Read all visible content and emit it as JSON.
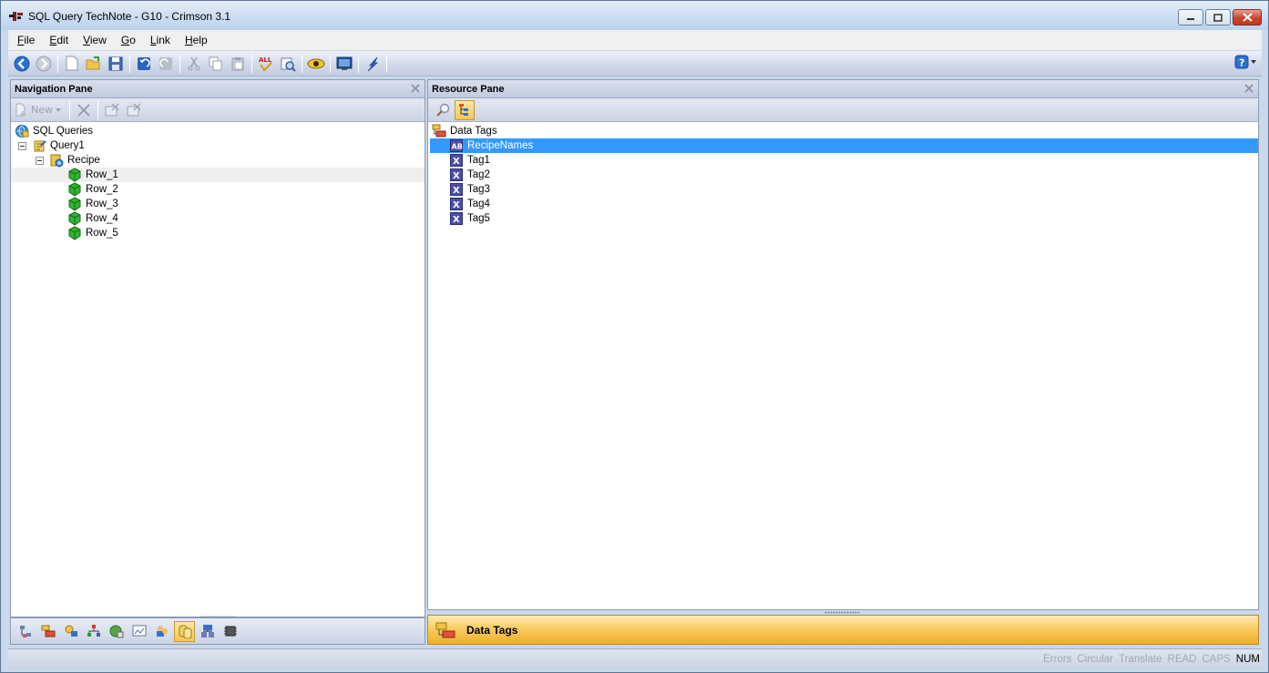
{
  "window": {
    "title": "SQL Query TechNote - G10 - Crimson 3.1"
  },
  "menu": {
    "items": [
      {
        "label": "File",
        "key": "F",
        "rest": "ile"
      },
      {
        "label": "Edit",
        "key": "E",
        "rest": "dit"
      },
      {
        "label": "View",
        "key": "V",
        "rest": "iew"
      },
      {
        "label": "Go",
        "key": "G",
        "rest": "o"
      },
      {
        "label": "Link",
        "key": "L",
        "rest": "ink"
      },
      {
        "label": "Help",
        "key": "H",
        "rest": "elp"
      }
    ]
  },
  "navigation_pane": {
    "title": "Navigation Pane",
    "new_button_label": "New",
    "tree": {
      "root": "SQL Queries",
      "query": "Query1",
      "table": "Recipe",
      "rows": [
        "Row_1",
        "Row_2",
        "Row_3",
        "Row_4",
        "Row_5"
      ],
      "selected": "Row_1"
    }
  },
  "resource_pane": {
    "title": "Resource Pane",
    "tree": {
      "root": "Data Tags",
      "items": [
        {
          "label": "RecipeNames",
          "kind": "string-tag",
          "selected": true
        },
        {
          "label": "Tag1",
          "kind": "numeric-tag",
          "selected": false
        },
        {
          "label": "Tag2",
          "kind": "numeric-tag",
          "selected": false
        },
        {
          "label": "Tag3",
          "kind": "numeric-tag",
          "selected": false
        },
        {
          "label": "Tag4",
          "kind": "numeric-tag",
          "selected": false
        },
        {
          "label": "Tag5",
          "kind": "numeric-tag",
          "selected": false
        }
      ]
    },
    "category_label": "Data Tags"
  },
  "status_bar": {
    "indicators": [
      {
        "label": "Errors",
        "active": false
      },
      {
        "label": "Circular",
        "active": false
      },
      {
        "label": "Translate",
        "active": false
      },
      {
        "label": "READ",
        "active": false
      },
      {
        "label": "CAPS",
        "active": false
      },
      {
        "label": "NUM",
        "active": true
      }
    ]
  },
  "colors": {
    "selection": "#3399ff",
    "accent_orange": "#f9ca5c",
    "window_frame": "#c9d8ea"
  }
}
